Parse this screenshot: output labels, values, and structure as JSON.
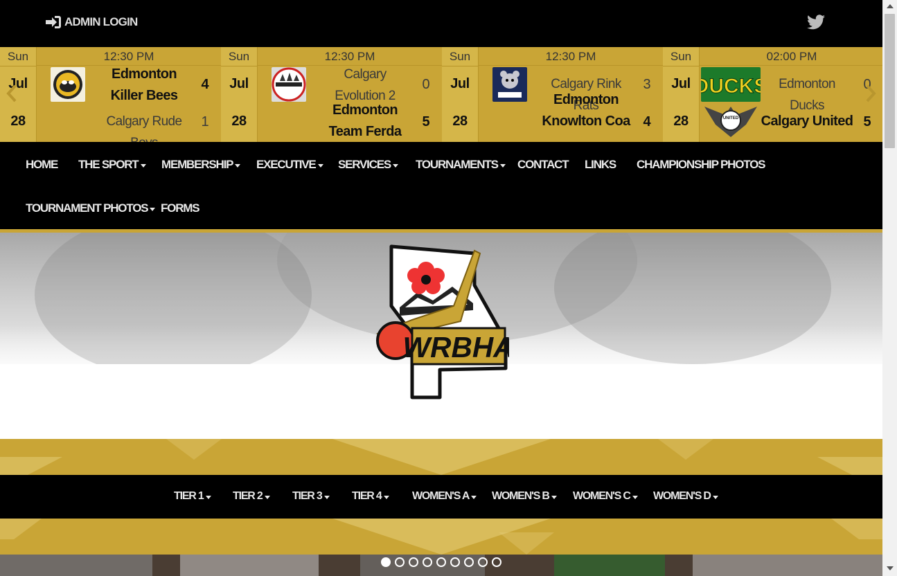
{
  "topbar": {
    "admin_label": "ADMIN LOGIN",
    "twitter_icon": "twitter-icon"
  },
  "games": [
    {
      "dow": "Sun",
      "month": "Jul",
      "day": "28",
      "time": "12:30 PM",
      "top": {
        "name": "Edmonton Killer Bees",
        "score": "4",
        "winner": true
      },
      "bottom": {
        "name": "Calgary Rude Boys",
        "score": "1",
        "winner": false
      }
    },
    {
      "dow": "Sun",
      "month": "Jul",
      "day": "28",
      "time": "12:30 PM",
      "top": {
        "name": "Calgary Evolution 2",
        "score": "0",
        "winner": false
      },
      "bottom": {
        "name": "Edmonton Team Ferda",
        "score": "5",
        "winner": true
      }
    },
    {
      "dow": "Sun",
      "month": "Jul",
      "day": "28",
      "time": "12:30 PM",
      "top": {
        "name": "Calgary Rink Rats",
        "score": "3",
        "winner": false
      },
      "bottom": {
        "name": "Edmonton Knowlton Coa",
        "score": "4",
        "winner": true
      }
    },
    {
      "dow": "Sun",
      "month": "Jul",
      "day": "28",
      "time": "02:00 PM",
      "top": {
        "name": "Edmonton Ducks",
        "score": "0",
        "winner": false
      },
      "bottom": {
        "name": "Calgary United",
        "score": "5",
        "winner": true
      }
    }
  ],
  "logo_texts": {
    "ducks": "DUCKS",
    "united": "UNITED"
  },
  "nav": {
    "items": [
      {
        "label": "HOME",
        "dropdown": false
      },
      {
        "label": "THE SPORT",
        "dropdown": true
      },
      {
        "label": "MEMBERSHIP",
        "dropdown": true
      },
      {
        "label": "EXECUTIVE",
        "dropdown": true
      },
      {
        "label": "SERVICES",
        "dropdown": true
      },
      {
        "label": "TOURNAMENTS",
        "dropdown": true
      },
      {
        "label": "CONTACT",
        "dropdown": false
      },
      {
        "label": "LINKS",
        "dropdown": false
      },
      {
        "label": "CHAMPIONSHIP PHOTOS",
        "dropdown": false
      },
      {
        "label": "TOURNAMENT PHOTOS",
        "dropdown": true
      },
      {
        "label": "FORMS",
        "dropdown": false
      }
    ]
  },
  "hero": {
    "logo_text": "WRBHA"
  },
  "tiers": {
    "items": [
      {
        "label": "TIER 1"
      },
      {
        "label": "TIER 2"
      },
      {
        "label": "TIER 3"
      },
      {
        "label": "TIER 4"
      },
      {
        "label": "WOMEN'S A"
      },
      {
        "label": "WOMEN'S B"
      },
      {
        "label": "WOMEN'S C"
      },
      {
        "label": "WOMEN'S D"
      }
    ]
  },
  "carousel": {
    "dot_count": 9,
    "active_index": 0
  },
  "colors": {
    "gold": "#c9a536",
    "black": "#000000",
    "nav_text": "#e9e9e9"
  }
}
